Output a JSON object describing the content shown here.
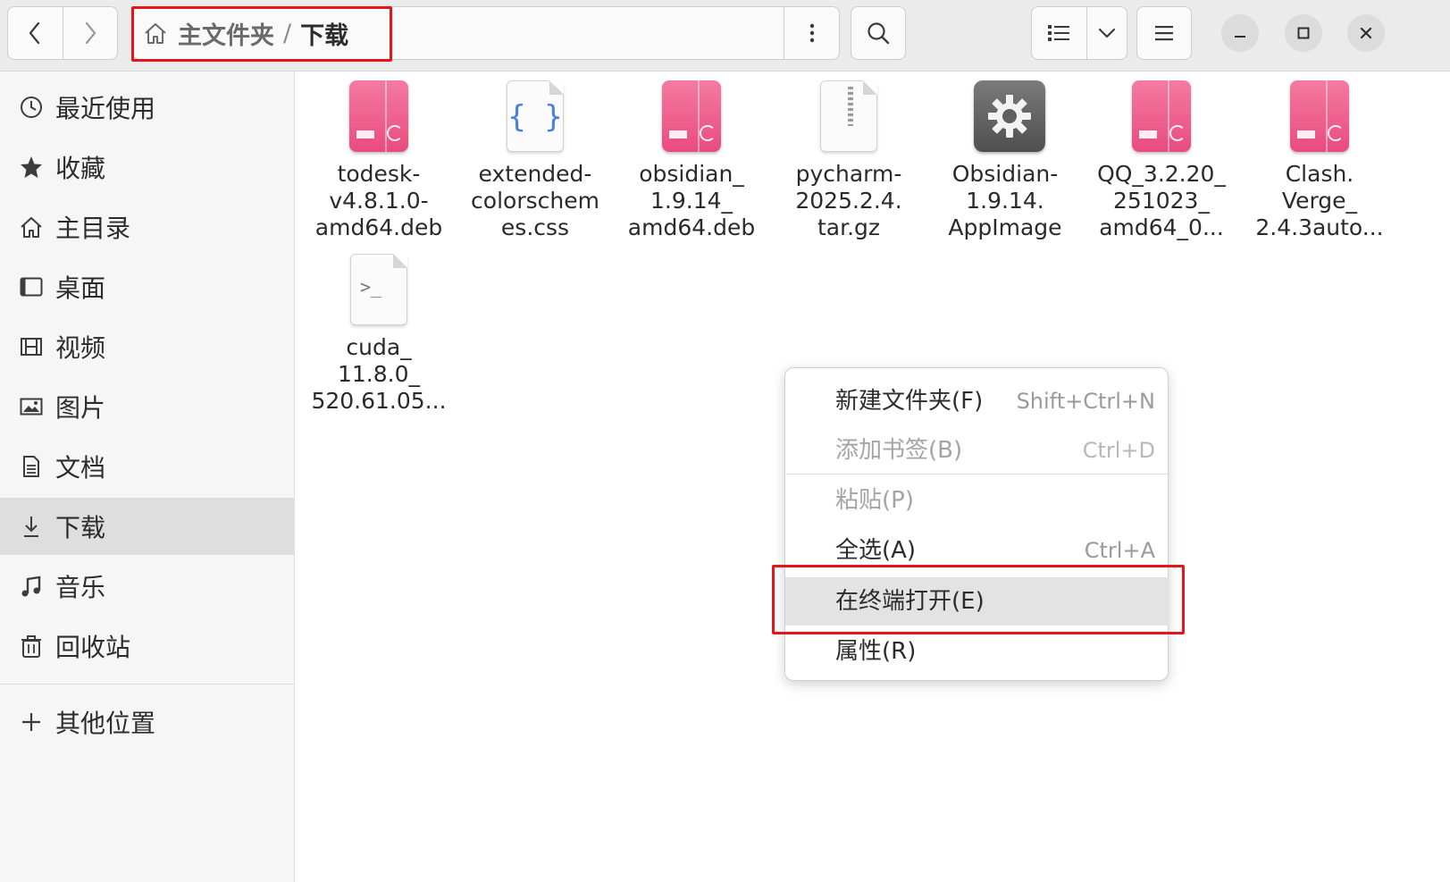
{
  "window": {
    "breadcrumb": {
      "home": "主文件夹",
      "separator": "/",
      "current": "下载"
    }
  },
  "sidebar": {
    "items": [
      {
        "label": "最近使用",
        "icon": "clock-icon"
      },
      {
        "label": "收藏",
        "icon": "star-icon"
      },
      {
        "label": "主目录",
        "icon": "home-icon"
      },
      {
        "label": "桌面",
        "icon": "desktop-icon"
      },
      {
        "label": "视频",
        "icon": "film-icon"
      },
      {
        "label": "图片",
        "icon": "image-icon"
      },
      {
        "label": "文档",
        "icon": "document-icon"
      },
      {
        "label": "下载",
        "icon": "download-icon",
        "active": true
      },
      {
        "label": "音乐",
        "icon": "music-icon"
      },
      {
        "label": "回收站",
        "icon": "trash-icon"
      }
    ],
    "other": {
      "label": "其他位置",
      "icon": "plus-icon"
    }
  },
  "files": [
    {
      "name_lines": [
        "todesk-",
        "v4.8.1.0-",
        "amd64.deb"
      ],
      "type": "deb"
    },
    {
      "name_lines": [
        "extended-",
        "colorschem",
        "es.css"
      ],
      "type": "css",
      "glyph": "{ }"
    },
    {
      "name_lines": [
        "obsidian_",
        "1.9.14_",
        "amd64.deb"
      ],
      "type": "deb"
    },
    {
      "name_lines": [
        "pycharm-",
        "2025.2.4.",
        "tar.gz"
      ],
      "type": "archive"
    },
    {
      "name_lines": [
        "Obsidian-",
        "1.9.14.",
        "AppImage"
      ],
      "type": "appimage"
    },
    {
      "name_lines": [
        "QQ_3.2.20_",
        "251023_",
        "amd64_0..."
      ],
      "type": "deb"
    },
    {
      "name_lines": [
        "Clash.",
        "Verge_",
        "2.4.3auto..."
      ],
      "type": "deb"
    },
    {
      "name_lines": [
        "cuda_",
        "11.8.0_",
        "520.61.05..."
      ],
      "type": "script",
      "glyph": ">_"
    }
  ],
  "context_menu": {
    "items": [
      {
        "label": "新建文件夹(F)",
        "shortcut": "Shift+Ctrl+N",
        "enabled": true
      },
      {
        "label": "添加书签(B)",
        "shortcut": "Ctrl+D",
        "enabled": false
      },
      {
        "label": "粘贴(P)",
        "shortcut": "",
        "enabled": false
      },
      {
        "label": "全选(A)",
        "shortcut": "Ctrl+A",
        "enabled": true
      },
      {
        "label": "在终端打开(E)",
        "shortcut": "",
        "enabled": true,
        "hovered": true
      },
      {
        "label": "属性(R)",
        "shortcut": "",
        "enabled": true
      }
    ]
  },
  "colors": {
    "highlight_box": "#e3161c",
    "deb_pink": "#e94b7f",
    "sidebar_active": "#dedede"
  }
}
